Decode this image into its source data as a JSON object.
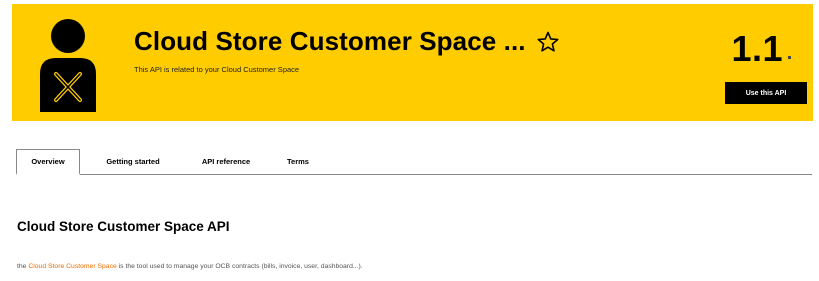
{
  "header": {
    "title": "Cloud Store Customer Space ...",
    "subtitle": "This API is related to your Cloud Customer Space",
    "version": "1.1",
    "use_api_label": "Use this API",
    "icons": {
      "avatar": "developer-avatar-icon",
      "favorite": "star-outline-icon"
    },
    "colors": {
      "banner": "#ffcc00",
      "button": "#000000"
    }
  },
  "tabs": [
    {
      "label": "Overview",
      "active": true
    },
    {
      "label": "Getting started",
      "active": false
    },
    {
      "label": "API reference",
      "active": false
    },
    {
      "label": "Terms",
      "active": false
    }
  ],
  "content": {
    "section_title": "Cloud Store Customer Space API",
    "desc_prefix": "the",
    "desc_link": "Cloud Store Customer Space",
    "desc_suffix": "is the tool used to manage your OCB contracts (bills, invoice, user, dashboard...).",
    "link_color": "#f16e00"
  }
}
